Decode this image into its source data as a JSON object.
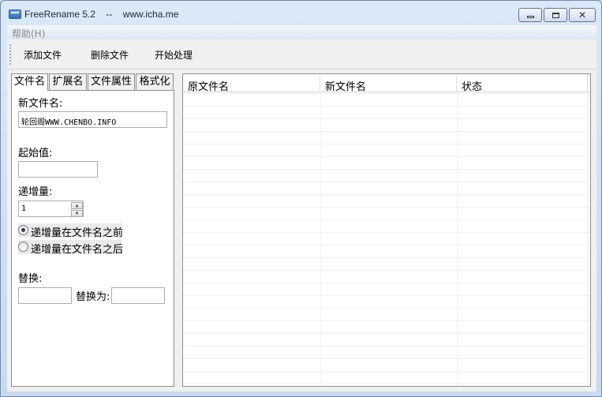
{
  "window": {
    "title": "FreeRename 5.2    --    www.icha.me"
  },
  "menu": {
    "help": "帮助(H)"
  },
  "toolbar": {
    "add_file": "添加文件",
    "delete_file": "删除文件",
    "start_process": "开始处理"
  },
  "tabs": [
    "文件名",
    "扩展名",
    "文件属性",
    "格式化"
  ],
  "filename_tab": {
    "new_name_label": "新文件名:",
    "new_name_value": "轮回阁WWW.CHENBO.INFO",
    "start_label": "起始值:",
    "start_value": "",
    "increment_label": "递增量:",
    "increment_value": "1",
    "radio_before": "递增量在文件名之前",
    "radio_after": "递增量在文件名之后",
    "replace_label": "替换:",
    "replace_value": "",
    "replace_with_label": "替换为:",
    "replace_with_value": ""
  },
  "grid": {
    "columns": [
      "原文件名",
      "新文件名",
      "状态"
    ]
  }
}
